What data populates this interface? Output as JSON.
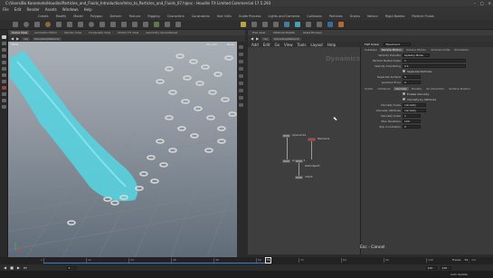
{
  "window": {
    "title": "C:/Users/Bo Kanemoto/Houdini/Particles_and_Fluids_Introduction/Intro_to_Particles_and_Fluids_07.hipnc - Houdini FX Limited Commercial 17.5.293"
  },
  "menu": [
    "File",
    "Edit",
    "Render",
    "Assets",
    "Windows",
    "Help"
  ],
  "shelf_tabs": [
    "Create",
    "Modify",
    "Model",
    "Polygon",
    "Deform",
    "Texture",
    "Rigging",
    "Characters",
    "Constraints",
    "Hair Utils",
    "Guide Process",
    "Terrain FX",
    "Cloud FX",
    "Volume"
  ],
  "shelf_tabs_right": [
    "Lights and Cameras",
    "Collisions",
    "Particles",
    "Grains",
    "Vellum",
    "Rigid Bodies",
    "Particle Fluids",
    "Viscous Fluids",
    "Oceans",
    "Fluid Containers",
    "Populate Containers",
    "Container Tools",
    "Pyro FX"
  ],
  "viewport": {
    "tabs": [
      "Scene View",
      "Animation Editor",
      "Render View",
      "Composite View",
      "Motion FX View",
      "Geometry Spreadsheet"
    ],
    "path": [
      "obj",
      "SolverDopNetwork"
    ],
    "label": "View",
    "camera": "No cam",
    "mode": "Persp"
  },
  "network": {
    "tabs": [
      "Tree View",
      "Material Palette",
      "Asset Browser"
    ],
    "path": [
      "obj",
      "SolverDopNetwork"
    ],
    "menu": [
      "Add",
      "Edit",
      "Go",
      "View",
      "Tools",
      "Layout",
      "Help"
    ],
    "watermark": "Dynamics",
    "nodes": [
      {
        "name": "popsource1"
      },
      {
        "name": "popsolver1"
      },
      {
        "name": "flipsolver1"
      },
      {
        "name": "staticobject1"
      },
      {
        "name": "output"
      }
    ]
  },
  "params": {
    "node_type": "FLIP Solver",
    "node_name": "flipsolver1",
    "top_tabs": [
      "Substeps",
      "Particle Motion",
      "Volume Motion",
      "Volume Limits",
      "Simulation"
    ],
    "rows": [
      {
        "label": "Velocity Transfer",
        "value": "Splashy Mode"
      },
      {
        "label": "Particle Radius Scale",
        "value": "1"
      },
      {
        "label": "Velocity Smoothing",
        "value": "0.1"
      }
    ],
    "checkbox": "Separate Particles",
    "rows2": [
      {
        "label": "Separate Surface",
        "value": "0"
      },
      {
        "label": "Jacobian Error",
        "value": "0"
      }
    ],
    "sub_tabs": [
      "Solver",
      "Collisions",
      "Viscosity",
      "Density",
      "Air Advection",
      "Surface Tension"
    ],
    "checks2": [
      "Enable Viscosity",
      "Viscosity by Attribute"
    ],
    "rows3": [
      {
        "label": "Viscosity Scale",
        "value": "viscosity"
      },
      {
        "label": "Viscosity Attribute",
        "value": "viscosity"
      },
      {
        "label": "Viscosity Scale",
        "value": "1"
      },
      {
        "label": "Max Iterations",
        "value": "100"
      },
      {
        "label": "Slip on Collision",
        "value": "0"
      }
    ]
  },
  "cancel_hint": "Esc - Cancel",
  "timeline": {
    "ticks": [
      "1",
      "12",
      "24",
      "36",
      "48",
      "60",
      "72",
      "84",
      "96",
      "108",
      "120"
    ],
    "start": "1",
    "end": "120",
    "current": "74",
    "end_field": "120"
  },
  "status": {
    "auto_update": "Auto Update",
    "frame_label": "Frame",
    "frame_value": "74"
  }
}
